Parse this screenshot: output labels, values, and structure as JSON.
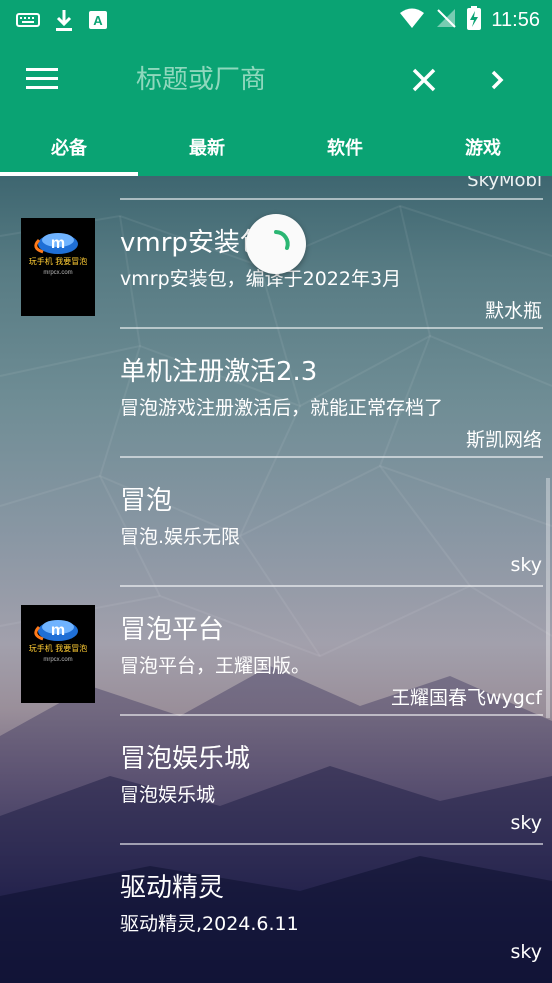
{
  "status_bar": {
    "time": "11:56",
    "left_icons": [
      "keyboard-icon",
      "download-icon",
      "app-badge-icon"
    ],
    "right_icons": [
      "wifi-icon",
      "no-signal-icon",
      "battery-charging-icon"
    ]
  },
  "app_bar": {
    "search_placeholder": "标题或厂商",
    "icons": [
      "menu-icon",
      "close-icon",
      "chevron-right-icon"
    ]
  },
  "tabs": [
    {
      "label": "必备",
      "active": true
    },
    {
      "label": "最新",
      "active": false
    },
    {
      "label": "软件",
      "active": false
    },
    {
      "label": "游戏",
      "active": false
    }
  ],
  "list": {
    "partial_author": "SkyMobi",
    "items": [
      {
        "title": "vmrp安装包",
        "desc": "vmrp安装包，编译于2022年3月",
        "author": "默水瓶",
        "has_thumb": true
      },
      {
        "title": "单机注册激活2.3",
        "desc": "冒泡游戏注册激活后，就能正常存档了",
        "author": "斯凯网络",
        "has_thumb": false
      },
      {
        "title": "冒泡",
        "desc": "冒泡.娱乐无限",
        "author": "sky",
        "has_thumb": false
      },
      {
        "title": "冒泡平台",
        "desc": "冒泡平台，王耀国版。",
        "author": "王耀国春飞wygcf",
        "has_thumb": true
      },
      {
        "title": "冒泡娱乐城",
        "desc": "冒泡娱乐城",
        "author": "sky",
        "has_thumb": false
      },
      {
        "title": "驱动精灵",
        "desc": "驱动精灵,2024.6.11",
        "author": "sky",
        "has_thumb": false
      }
    ],
    "thumb_logo_text": "m",
    "thumb_caption": "玩手机 我要冒泡",
    "thumb_url": "mrpcx.com"
  },
  "colors": {
    "primary": "#0aa373",
    "spinner_accent": "#2bb673"
  }
}
